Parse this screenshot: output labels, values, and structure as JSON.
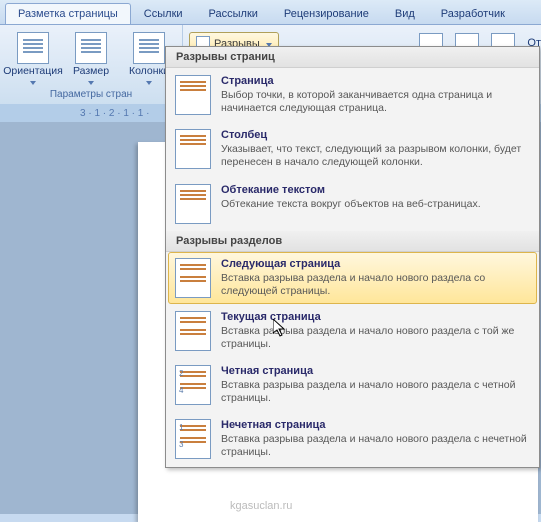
{
  "tabs": {
    "active": "Разметка страницы",
    "items": [
      "Разметка страницы",
      "Ссылки",
      "Рассылки",
      "Рецензирование",
      "Вид",
      "Разработчик"
    ]
  },
  "ribbon": {
    "orientation": "Ориентация",
    "size": "Размер",
    "columns": "Колонки",
    "breaks": "Разрывы",
    "group_label": "Параметры стран",
    "more_label": "От"
  },
  "ruler_hint": "3 · 1 · 2 · 1 · 1 ·",
  "dropdown": {
    "section1": "Разрывы страниц",
    "section2": "Разрывы разделов",
    "items1": [
      {
        "title": "Страница",
        "desc": "Выбор точки, в которой заканчивается одна страница и начинается следующая страница."
      },
      {
        "title": "Столбец",
        "desc": "Указывает, что текст, следующий за разрывом колонки, будет перенесен в начало следующей колонки."
      },
      {
        "title": "Обтекание текстом",
        "desc": "Обтекание текста вокруг объектов на веб-страницах."
      }
    ],
    "items2": [
      {
        "title": "Следующая страница",
        "desc": "Вставка разрыва раздела и начало нового раздела со следующей страницы."
      },
      {
        "title": "Текущая страница",
        "desc": "Вставка разрыва раздела и начало нового раздела с той же страницы."
      },
      {
        "title": "Четная страница",
        "desc": "Вставка разрыва раздела и начало нового раздела с четной страницы."
      },
      {
        "title": "Нечетная страница",
        "desc": "Вставка разрыва раздела и начало нового раздела с нечетной страницы."
      }
    ]
  },
  "watermark": "kgasuclan.ru"
}
